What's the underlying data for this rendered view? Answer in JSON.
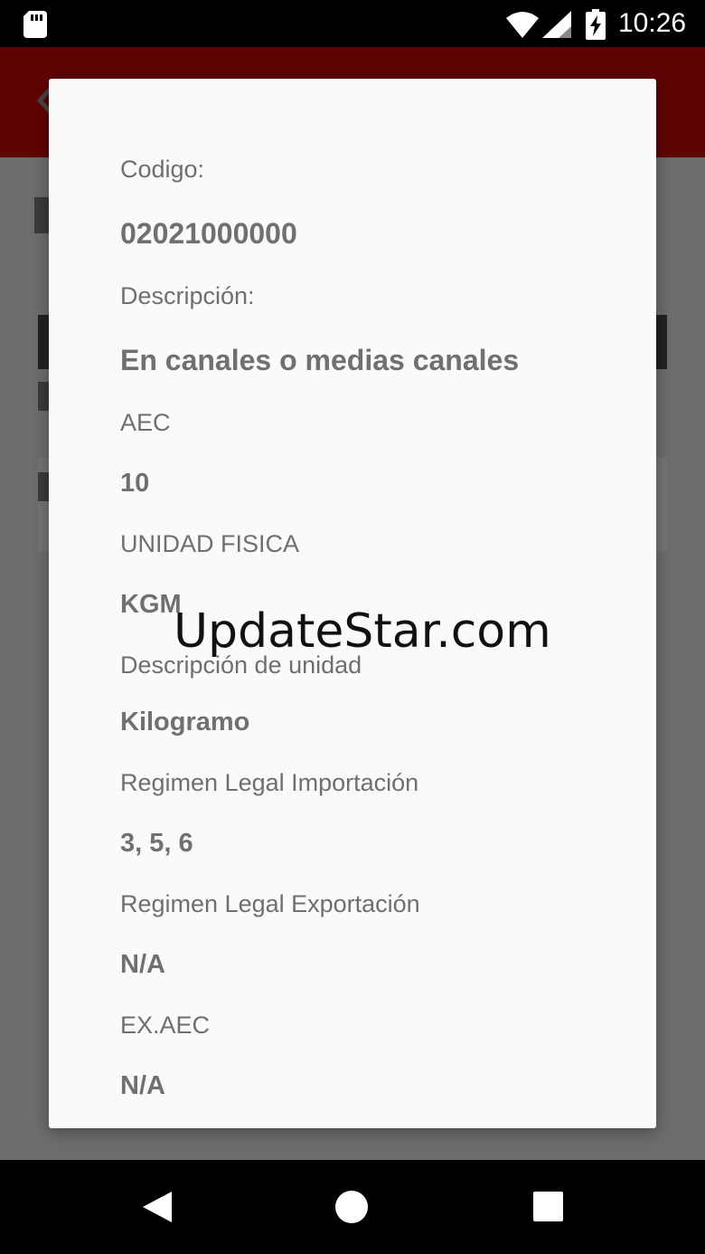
{
  "status_bar": {
    "time": "10:26",
    "icons": [
      "sd-card-icon",
      "wifi-icon",
      "signal-icon",
      "battery-charging-icon"
    ]
  },
  "dialog": {
    "fields": [
      {
        "label": "Codigo:",
        "value": "02021000000"
      },
      {
        "label": "Descripción:",
        "value": "En canales o medias canales"
      },
      {
        "label": "AEC",
        "value": "10"
      },
      {
        "label": "UNIDAD FISICA",
        "value": "KGM"
      },
      {
        "label": "Descripción de unidad",
        "value": "Kilogramo"
      },
      {
        "label": "Regimen Legal Importación",
        "value": "3, 5, 6"
      },
      {
        "label": "Regimen Legal Exportación",
        "value": "N/A"
      },
      {
        "label": "EX.AEC",
        "value": "N/A"
      }
    ]
  },
  "watermark": "UpdateStar.com",
  "colors": {
    "app_bar": "#5e0404",
    "dialog_bg": "#fafafa",
    "text_gray": "#707070"
  },
  "nav_bar": {
    "icons": [
      "back-icon",
      "home-icon",
      "recents-icon"
    ]
  }
}
